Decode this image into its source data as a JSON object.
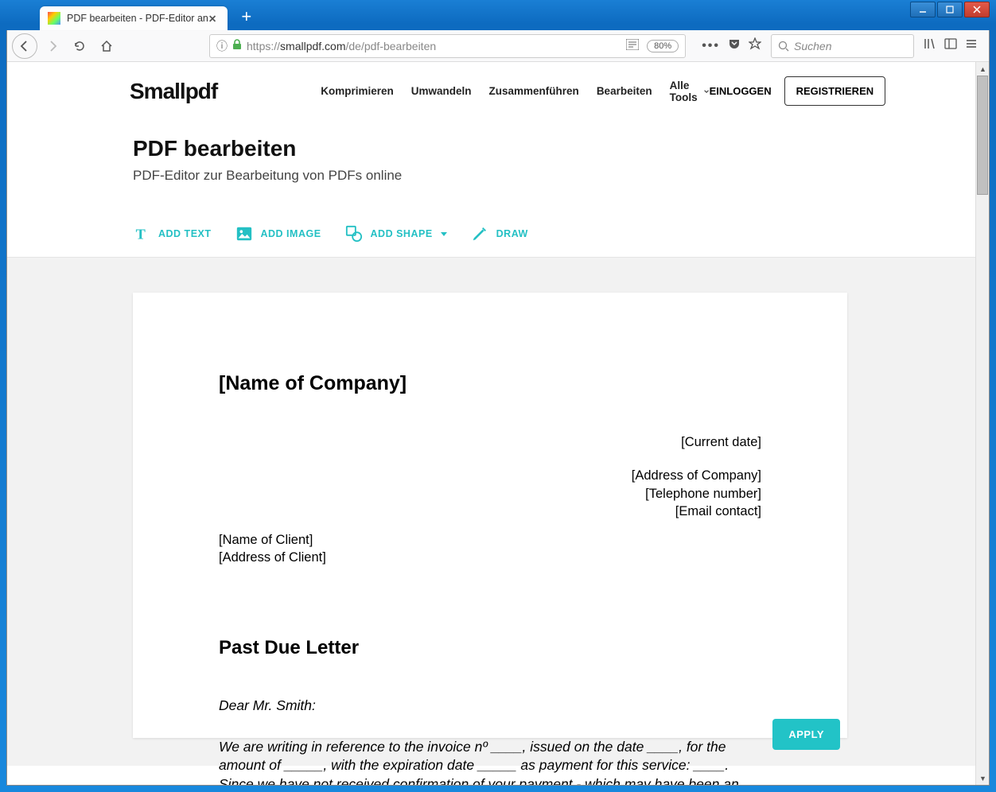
{
  "window": {
    "tab_title": "PDF bearbeiten - PDF-Editor an"
  },
  "browser": {
    "url_prefix": "https://",
    "url_host": "smallpdf.com",
    "url_path": "/de/pdf-bearbeiten",
    "zoom": "80%",
    "search_placeholder": "Suchen"
  },
  "site": {
    "logo": "Smallpdf",
    "nav": {
      "compress": "Komprimieren",
      "convert": "Umwandeln",
      "merge": "Zusammenführen",
      "edit": "Bearbeiten",
      "alltools": "Alle Tools"
    },
    "auth": {
      "login": "EINLOGGEN",
      "register": "REGISTRIEREN"
    },
    "page_title": "PDF bearbeiten",
    "page_subtitle": "PDF-Editor zur Bearbeitung von PDFs online"
  },
  "editor_toolbar": {
    "add_text": "ADD TEXT",
    "add_image": "ADD IMAGE",
    "add_shape": "ADD SHAPE",
    "draw": "DRAW"
  },
  "document": {
    "company": "[Name of Company]",
    "current_date": "[Current date]",
    "address_company": "[Address of Company]",
    "telephone": "[Telephone number]",
    "email": "[Email contact]",
    "client_name": "[Name of Client]",
    "client_address": "[Address of Client]",
    "heading": "Past Due Letter",
    "salutation": "Dear Mr. Smith:",
    "body": "We are writing in reference to the invoice nº ____, issued on the date ____, for the amount of _____, with the expiration date _____ as payment for this service: ____. Since we have not received confirmation of your payment - which may have been an"
  },
  "apply_button": "APPLY"
}
